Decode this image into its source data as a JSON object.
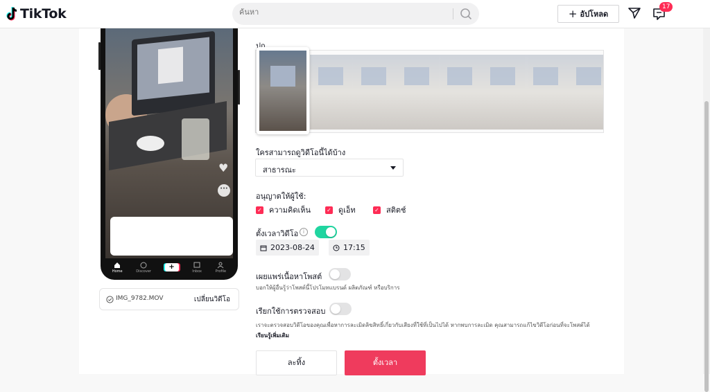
{
  "header": {
    "logo_text": "TikTok",
    "search_placeholder": "ค้นหา",
    "upload_label": "อัปโหลด",
    "inbox_badge": "17"
  },
  "preview": {
    "nav": [
      "Home",
      "Discover",
      "Inbox",
      "Profile"
    ],
    "file_name": "IMG_9782.MOV",
    "change_video": "เปลี่ยนวิดีโอ"
  },
  "form": {
    "cover_label": "ปก",
    "privacy_label": "ใครสามารถดูวิดีโอนี้ได้บ้าง",
    "privacy_value": "สาธารณะ",
    "allow_label": "อนุญาตให้ผู้ใช้:",
    "allow_options": [
      {
        "label": "ความคิดเห็น",
        "checked": true
      },
      {
        "label": "ดูเอ็ท",
        "checked": true
      },
      {
        "label": "สติตช์",
        "checked": true
      }
    ],
    "schedule_label": "ตั้งเวลาวิดีโอ",
    "schedule_on": true,
    "schedule_date": "2023-08-24",
    "schedule_time": "17:15",
    "disclose_label": "เผยแพร่เนื้อหาโพสต์",
    "disclose_on": false,
    "disclose_desc": "บอกให้ผู้อื่นรู้ว่าโพสต์นี้โปรโมทแบรนด์ ผลิตภัณฑ์ หรือบริการ",
    "check_label": "เรียกใช้การตรวจสอบ",
    "check_on": false,
    "check_desc": "เราจะตรวจสอบวิดีโอของคุณเพื่อหาการละเมิดลิขสิทธิ์เกี่ยวกับเสียงที่ใช้ที่เป็นไปได้ หากพบการละเมิด คุณสามารถแก้ไขวิดีโอก่อนที่จะโพสต์ได้",
    "learn_more": "เรียนรู้เพิ่มเติม",
    "discard_label": "ละทิ้ง",
    "schedule_button": "ตั้งเวลา"
  },
  "colors": {
    "accent": "#fe2c55",
    "schedule_button": "#ef3b5d",
    "toggle_on": "#20d5a0"
  }
}
